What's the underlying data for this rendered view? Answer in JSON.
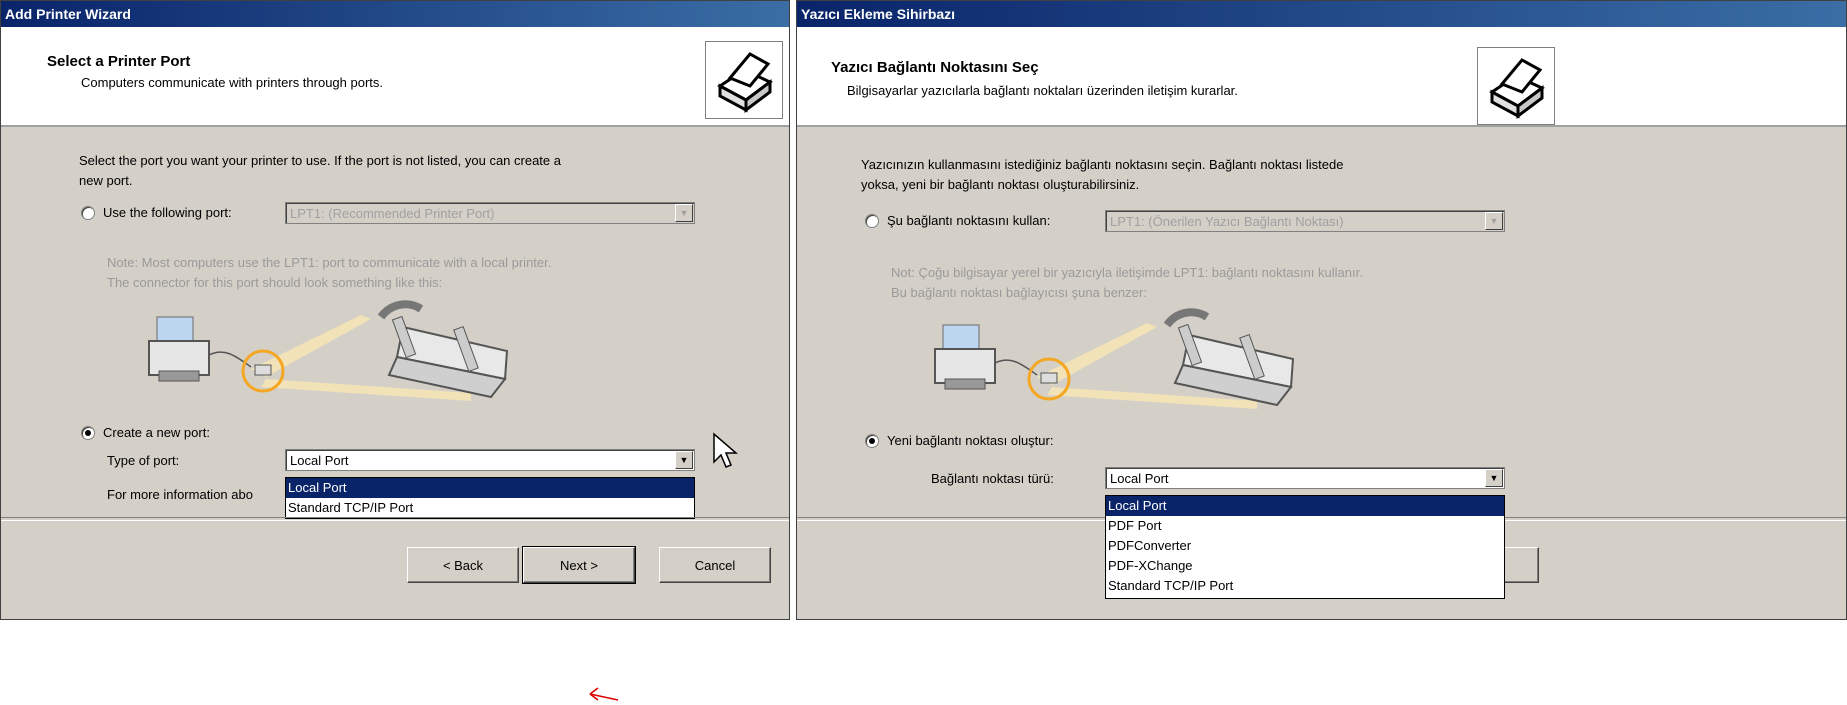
{
  "left": {
    "title": "Add Printer Wizard",
    "header_title": "Select a Printer Port",
    "header_sub": "Computers communicate with printers through ports.",
    "intro_line1": "Select the port you want your printer to use.  If the port is not listed, you can create a",
    "intro_line2": "new port.",
    "use_port_label": "Use the following port:",
    "use_port_value": "LPT1: (Recommended Printer Port)",
    "note_line1": "Note: Most computers use the LPT1: port to communicate with a local printer.",
    "note_line2": "The connector for this port should look something like this:",
    "create_port_label": "Create a new port:",
    "type_of_port_label": "Type of port:",
    "type_of_port_value": "Local Port",
    "more_info": "For more information abo",
    "options": [
      "Local Port",
      "Standard TCP/IP Port"
    ],
    "back": "< Back",
    "next": "Next >",
    "cancel": "Cancel"
  },
  "right": {
    "title": "Yazıcı Ekleme Sihirbazı",
    "header_title": "Yazıcı Bağlantı Noktasını Seç",
    "header_sub": "Bilgisayarlar yazıcılarla bağlantı noktaları üzerinden iletişim kurarlar.",
    "intro_line1": "Yazıcınızın kullanmasını istediğiniz bağlantı noktasını seçin. Bağlantı noktası listede",
    "intro_line2": "yoksa, yeni bir bağlantı noktası oluşturabilirsiniz.",
    "use_port_label": "Şu bağlantı noktasını kullan:",
    "use_port_value": "LPT1: (Önerilen Yazıcı Bağlantı Noktası)",
    "note_line1": "Not: Çoğu bilgisayar yerel bir yazıcıyla iletişimde LPT1: bağlantı noktasını kullanır.",
    "note_line2": "Bu bağlantı noktası bağlayıcısı şuna benzer:",
    "create_port_label": "Yeni bağlantı noktası oluştur:",
    "type_of_port_label": "Bağlantı noktası türü:",
    "type_of_port_value": "Local Port",
    "options": [
      "Local Port",
      "PDF Port",
      "PDFConverter",
      "PDF-XChange",
      "Standard TCP/IP Port"
    ]
  },
  "colors": {
    "selection": "#0a246a",
    "dialog_bg": "#d4d0c8",
    "port_highlight": "#f5a623",
    "annotation_arrow": "#e00000"
  }
}
